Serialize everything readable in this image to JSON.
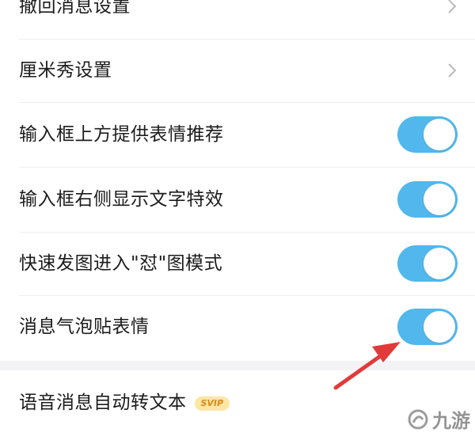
{
  "settings": {
    "items": [
      {
        "label": "撤回消息设置",
        "control": "chevron"
      },
      {
        "label": "厘米秀设置",
        "control": "chevron"
      },
      {
        "label": "输入框上方提供表情推荐",
        "control": "toggle",
        "on": true
      },
      {
        "label": "输入框右侧显示文字特效",
        "control": "toggle",
        "on": true
      },
      {
        "label": "快速发图进入\"怼\"图模式",
        "control": "toggle",
        "on": true
      },
      {
        "label": "消息气泡贴表情",
        "control": "toggle",
        "on": true
      },
      {
        "label": "语音消息自动转文本",
        "badge": "SVIP"
      }
    ]
  },
  "colors": {
    "toggle_on": "#51b7ec",
    "arrow": "#e23a3a",
    "svip_bg": "#fde7a2",
    "svip_text": "#d9881b"
  },
  "watermark": {
    "text": "九游"
  }
}
